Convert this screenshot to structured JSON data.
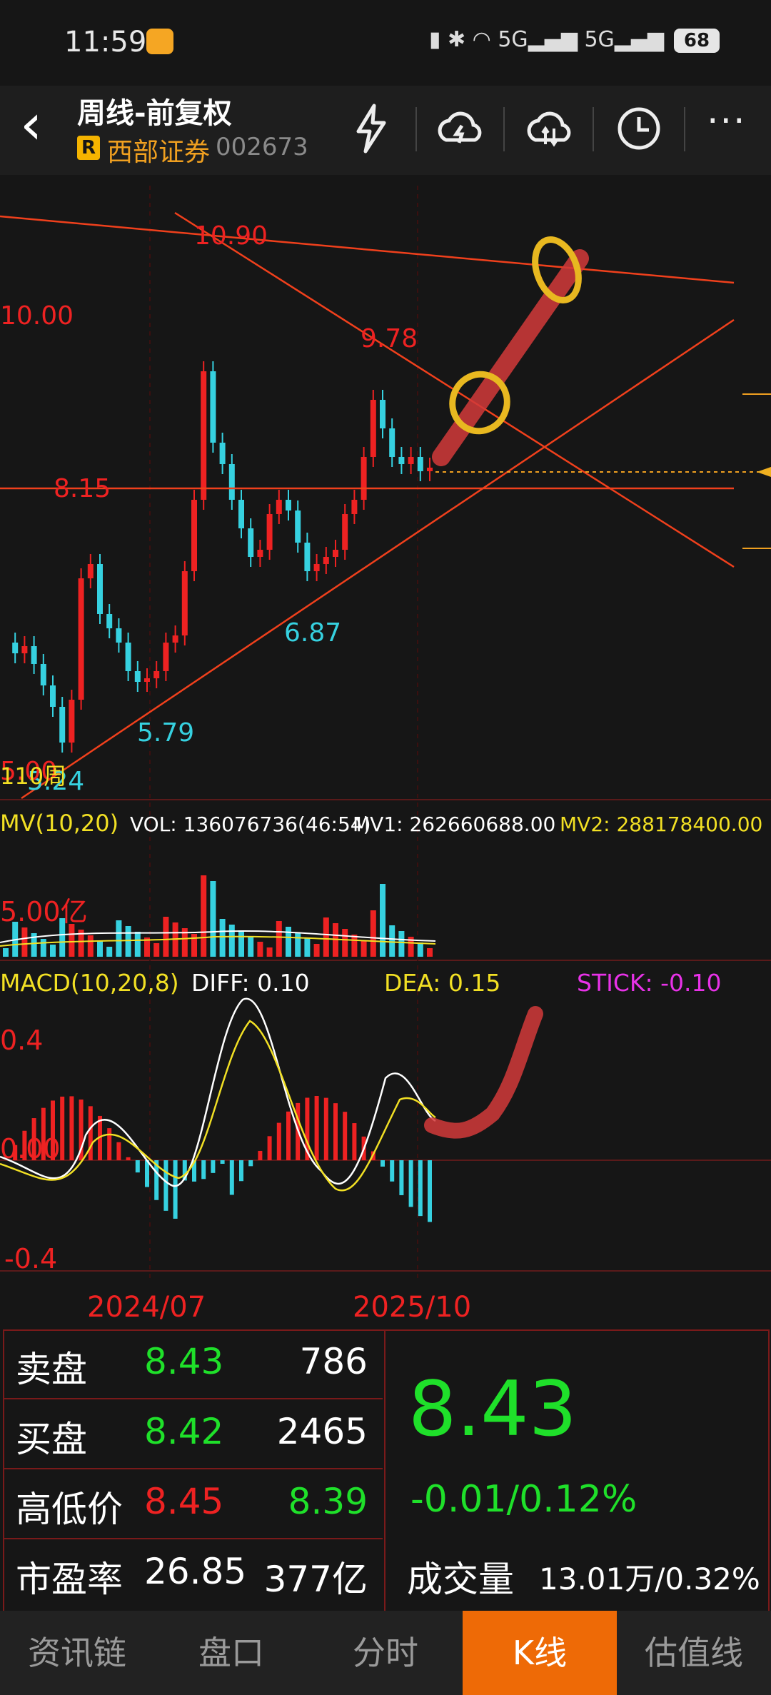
{
  "status_bar": {
    "time": "11:59",
    "battery": "68",
    "net1": "5G",
    "net2": "5G"
  },
  "header": {
    "title": "周线-前复权",
    "badge": "R",
    "stock_name": "西部证券",
    "stock_code": "002673"
  },
  "chart_labels": {
    "price_10_90": "10.90",
    "price_10_00": "10.00",
    "price_9_78": "9.78",
    "price_8_15": "8.15",
    "price_6_87": "6.87",
    "price_5_79": "5.79",
    "price_5_24": "5.24",
    "price_5_00": "5.00",
    "period_label": "110周"
  },
  "volume": {
    "title": "MV(10,20)",
    "vol": "VOL: 136076736(46:54)",
    "mv1": "MV1: 262660688.00",
    "mv2": "MV2: 288178400.00",
    "axis": "5.00亿"
  },
  "macd": {
    "title": "MACD(10,20,8)",
    "diff": "DIFF: 0.10",
    "dea": "DEA: 0.15",
    "stick": "STICK: -0.10",
    "axis_top": "0.4",
    "axis_mid": "0.00",
    "axis_bot": "-0.4"
  },
  "dates": {
    "d1": "2024/07",
    "d2": "2025/10"
  },
  "quote": {
    "sell_label": "卖盘",
    "sell_price": "8.43",
    "sell_vol": "786",
    "buy_label": "买盘",
    "buy_price": "8.42",
    "buy_vol": "2465",
    "hl_label": "高低价",
    "high": "8.45",
    "low": "8.39",
    "pe_label": "市盈率",
    "pe": "26.85",
    "mcap": "377亿",
    "last": "8.43",
    "change": "-0.01/0.12%",
    "turnover_label": "成交量",
    "turnover": "13.01万/0.32%"
  },
  "tabs": [
    "资讯链",
    "盘口",
    "分时",
    "K线",
    "估值线"
  ],
  "colors": {
    "up": "#ee2222",
    "down": "#36d1e0",
    "green": "#1fe02a",
    "yellow": "#f2e024",
    "magenta": "#e832e8",
    "accent": "#ee6a06"
  }
}
